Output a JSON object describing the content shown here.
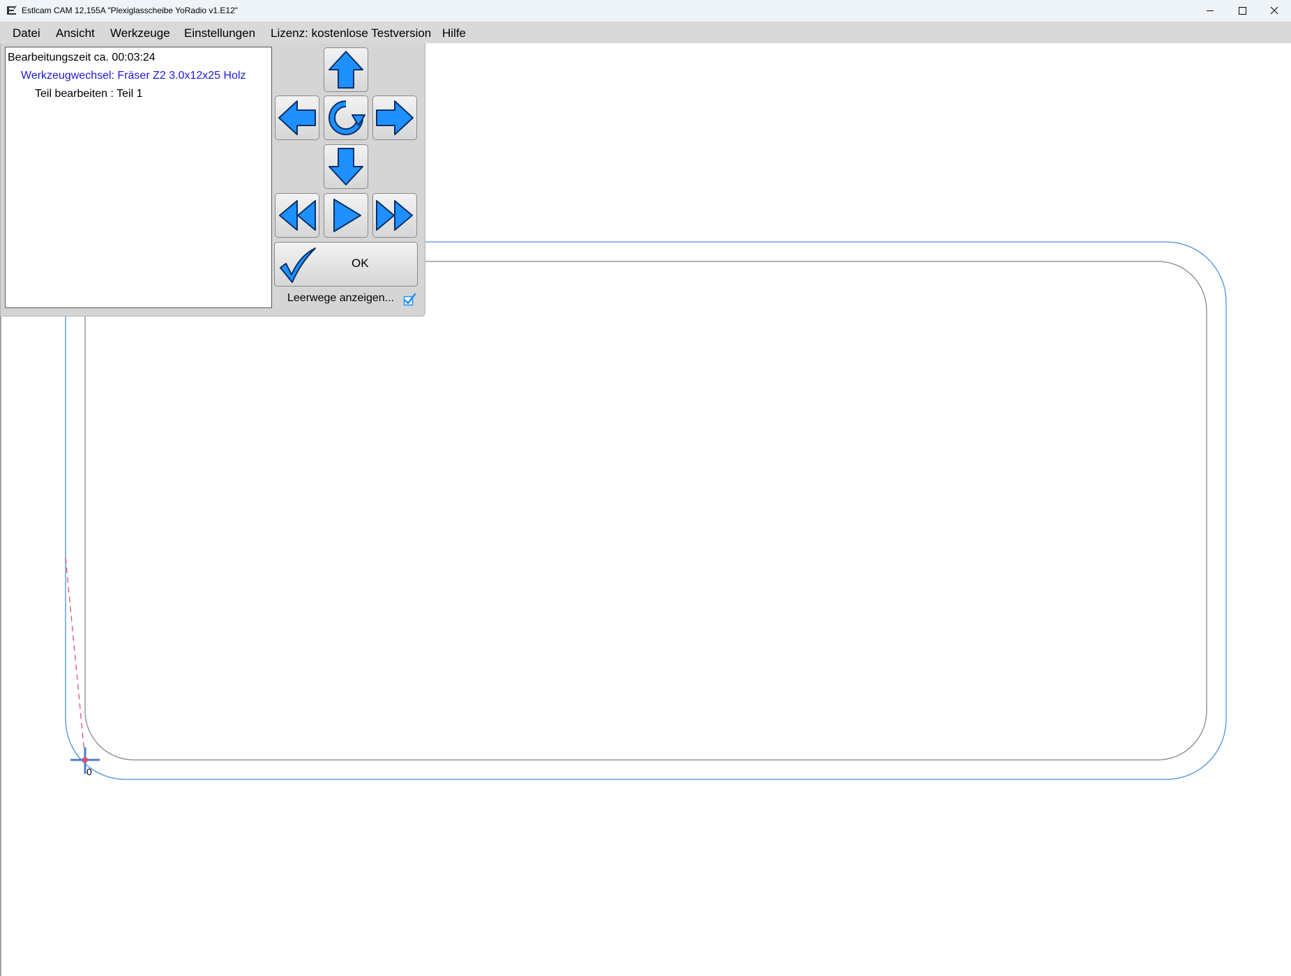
{
  "window": {
    "title": "Estlcam CAM 12,155A \"Plexiglasscheibe YoRadio v1.E12\"",
    "controls": [
      "minimize-icon",
      "maximize-icon",
      "close-icon"
    ]
  },
  "menu": {
    "items": [
      "Datei",
      "Ansicht",
      "Werkzeuge",
      "Einstellungen",
      "Lizenz: kostenlose Testversion",
      "Hilfe"
    ]
  },
  "log": {
    "time": "Bearbeitungszeit ca. 00:03:24",
    "tool_change": "Werkzeugwechsel: Fräser Z2 3.0x12x25 Holz",
    "part": "Teil bearbeiten : Teil 1"
  },
  "controls": {
    "buttons": [
      "arrow-up-icon",
      "arrow-left-icon",
      "rotate-icon",
      "arrow-right-icon",
      "arrow-down-icon",
      "rewind-icon",
      "play-icon",
      "fast-forward-icon"
    ],
    "ok_label": "OK",
    "idle_moves_label": "Leerwege anzeigen...",
    "idle_moves_checked": true
  },
  "canvas": {
    "origin_label": "0"
  },
  "colors": {
    "accent": "#1e90ff",
    "toolpath": "#4a90e2",
    "part_outline": "#808080",
    "rapid_move": "#e05070",
    "tool_change_text": "#1a1adc"
  }
}
